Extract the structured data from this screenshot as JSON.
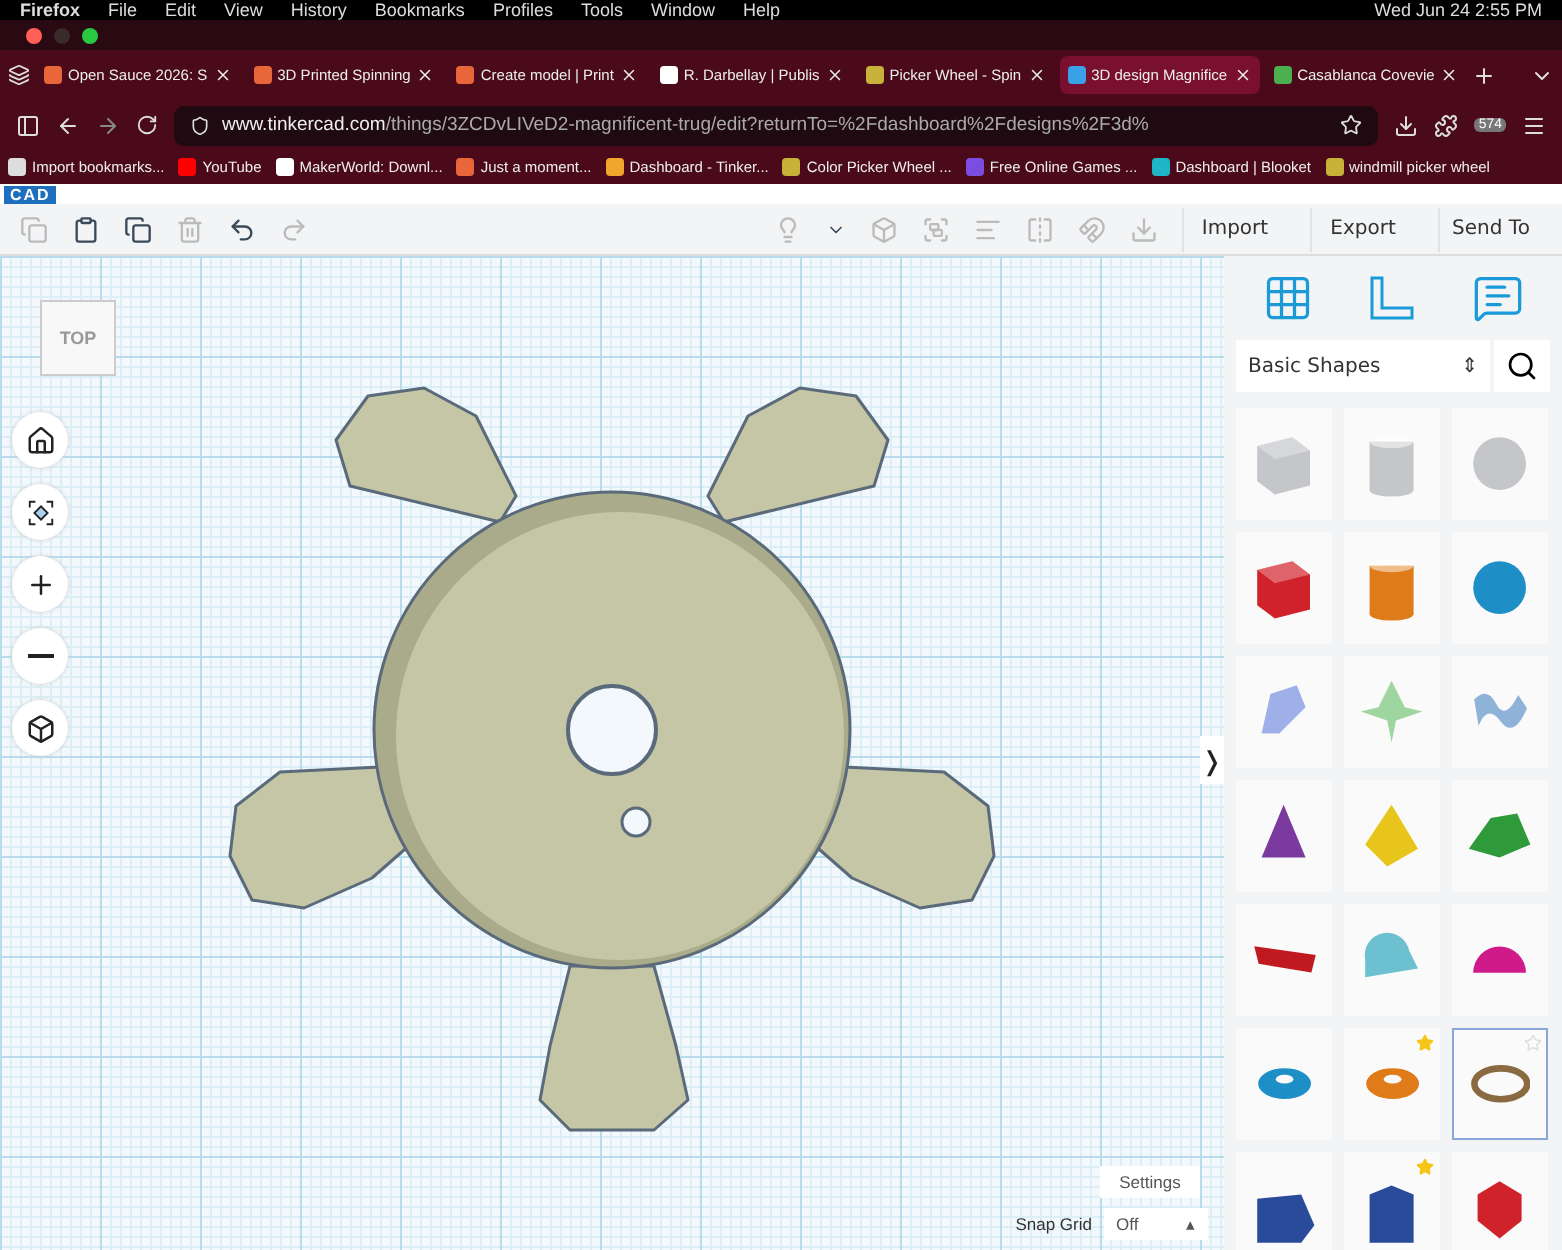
{
  "menu_bar": {
    "app": "Firefox",
    "items": [
      "File",
      "Edit",
      "View",
      "History",
      "Bookmarks",
      "Profiles",
      "Tools",
      "Window",
      "Help"
    ],
    "clock": "Wed Jun 24  2:55 PM"
  },
  "tabs": [
    {
      "label": "Open Sauce 2026: S",
      "selected": false,
      "color": "#e8663a"
    },
    {
      "label": "3D Printed Spinning",
      "selected": false,
      "color": "#e8663a"
    },
    {
      "label": "Create model | Print",
      "selected": false,
      "color": "#e8663a"
    },
    {
      "label": "R. Darbellay | Publis",
      "selected": false,
      "color": "#ffffff"
    },
    {
      "label": "Picker Wheel - Spin",
      "selected": false,
      "color": "#c9b23a"
    },
    {
      "label": "3D design Magnifice",
      "selected": true,
      "color": "#3aa0e8"
    },
    {
      "label": "Casablanca Covevie",
      "selected": false,
      "color": "#4caf50"
    }
  ],
  "address": {
    "host": "www.tinkercad.com",
    "path": "/things/3ZCDvLIVeD2-magnificent-trug/edit?returnTo=%2Fdashboard%2Fdesigns%2F3d%"
  },
  "tab_count": "574",
  "bookmarks": [
    {
      "label": "Import bookmarks...",
      "color": "#dddddd"
    },
    {
      "label": "YouTube",
      "color": "#ff0000"
    },
    {
      "label": "MakerWorld: Downl...",
      "color": "#ffffff"
    },
    {
      "label": "Just a moment...",
      "color": "#e8663a"
    },
    {
      "label": "Dashboard - Tinker...",
      "color": "#f2a52b"
    },
    {
      "label": "Color Picker Wheel ...",
      "color": "#c9b23a"
    },
    {
      "label": "Free Online Games ...",
      "color": "#7b4de0"
    },
    {
      "label": "Dashboard | Blooket",
      "color": "#1fb5c9"
    },
    {
      "label": "windmill picker wheel",
      "color": "#c9b23a"
    }
  ],
  "logo": "CAD",
  "actions": [
    "Import",
    "Export",
    "Send To"
  ],
  "view_cube": "TOP",
  "panel_toggle": "❭",
  "shape_category": "Basic Shapes",
  "shapes": [
    {
      "kind": "hole-box",
      "starred": false,
      "selected": false
    },
    {
      "kind": "hole-cylinder",
      "starred": false,
      "selected": false
    },
    {
      "kind": "hole-sphere",
      "starred": false,
      "selected": false
    },
    {
      "kind": "box",
      "starred": false,
      "selected": false
    },
    {
      "kind": "cylinder",
      "starred": false,
      "selected": false
    },
    {
      "kind": "sphere",
      "starred": false,
      "selected": false
    },
    {
      "kind": "scribble",
      "starred": false,
      "selected": false
    },
    {
      "kind": "graph",
      "starred": false,
      "selected": false
    },
    {
      "kind": "wave",
      "starred": false,
      "selected": false
    },
    {
      "kind": "cone",
      "starred": false,
      "selected": false
    },
    {
      "kind": "pyramid",
      "starred": false,
      "selected": false
    },
    {
      "kind": "roof",
      "starred": false,
      "selected": false
    },
    {
      "kind": "text",
      "starred": false,
      "selected": false
    },
    {
      "kind": "half-cylinder",
      "starred": false,
      "selected": false
    },
    {
      "kind": "half-sphere",
      "starred": false,
      "selected": false
    },
    {
      "kind": "torus",
      "starred": false,
      "selected": false
    },
    {
      "kind": "tube",
      "starred": true,
      "selected": false
    },
    {
      "kind": "ring",
      "starred": false,
      "selected": true
    },
    {
      "kind": "wedge",
      "starred": false,
      "selected": false
    },
    {
      "kind": "prism",
      "starred": true,
      "selected": false
    },
    {
      "kind": "gem",
      "starred": false,
      "selected": false
    }
  ],
  "settings_button": "Settings",
  "snap_grid": {
    "label": "Snap Grid",
    "value": "Off",
    "arrow": "▴"
  },
  "category_arrows": "⇕"
}
